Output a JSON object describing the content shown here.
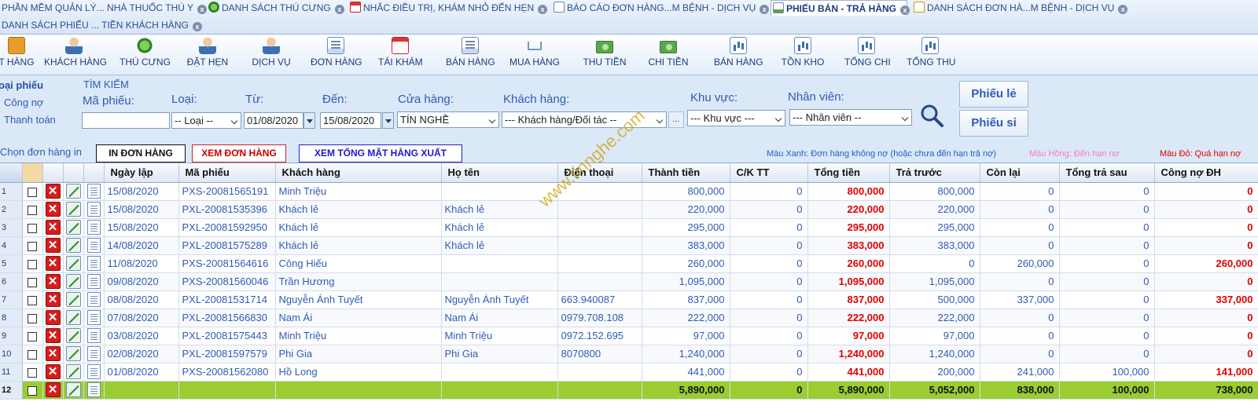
{
  "tabs": [
    {
      "label": "PHẦN MỀM QUẢN LÝ... NHÀ THUỐC THÚ Y",
      "icon": "app-icon",
      "active": false
    },
    {
      "label": "DANH SÁCH THÚ CƯNG",
      "icon": "pet-icon",
      "active": false
    },
    {
      "label": "NHẮC ĐIỀU TRỊ, KHÁM NHỎ ĐẾN HẸN",
      "icon": "calendar-icon",
      "active": false
    },
    {
      "label": "BÁO CÁO ĐƠN HÀNG...M BỆNH - DỊCH VỤ",
      "icon": "report-icon",
      "active": false
    },
    {
      "label": "PHIẾU BÁN - TRẢ HÀNG",
      "icon": "receipt-icon",
      "active": true
    },
    {
      "label": "DANH SÁCH ĐƠN HÀ...M BỆNH - DỊCH VỤ",
      "icon": "document-icon",
      "active": false
    },
    {
      "label": "DANH SÁCH PHIẾU ... TIỀN KHÁCH HÀNG",
      "icon": "",
      "active": false
    }
  ],
  "toolbar": [
    "T HÀNG",
    "KHÁCH HÀNG",
    "THÚ CƯNG",
    "ĐẶT HẸN",
    "DỊCH VỤ",
    "ĐƠN HÀNG",
    "TÁI KHÁM",
    "BÁN HÀNG",
    "MUA HÀNG",
    "THU TIỀN",
    "CHI TIỀN",
    "BÁN HÀNG",
    "TỒN KHO",
    "TỔNG CHI",
    "TỔNG THU"
  ],
  "filter": {
    "loai_phieu_label": "oại phiếu",
    "cong_no": "Công nợ",
    "thanh_toan": "Thanh toán",
    "tim_kiem": "TÌM KIẾM",
    "ma_phieu_label": "Mã phiếu:",
    "loai_label": "Loại:",
    "tu_label": "Từ:",
    "den_label": "Đến:",
    "cua_hang_label": "Cửa hàng:",
    "khach_hang_label": "Khách hàng:",
    "khu_vuc_label": "Khu vực:",
    "nhan_vien_label": "Nhân viên:",
    "ma_phieu_value": "",
    "loai_value": "-- Loại --",
    "tu_value": "01/08/2020",
    "den_value": "15/08/2020",
    "cua_hang_value": "TÍN NGHỀ",
    "khach_hang_value": "--- Khách hàng/Đối tác --",
    "more": "...",
    "khu_vuc_value": "--- Khu vực ---",
    "nhan_vien_value": "--- Nhân viên --",
    "phieu_le": "Phiếu lẻ",
    "phieu_si": "Phiếu sỉ"
  },
  "actions": {
    "chon_label": "Chọn đơn hàng in",
    "in": "IN ĐƠN HÀNG",
    "xem": "XEM ĐƠN HÀNG",
    "xem_tong": "XEM TỔNG MẶT HÀNG XUẤT",
    "legend_xanh": "Màu Xanh: Đơn hàng không nợ (hoặc chưa đến hạn trả nợ)",
    "legend_hong": "Màu Hồng: Đến hạn nợ",
    "legend_do": "Màu Đỏ: Quá hạn nợ",
    "color_xanh": "#1f5fbf",
    "color_hong": "#f07fc0",
    "color_do": "#e00000"
  },
  "columns": [
    "Ngày lập",
    "Mã phiếu",
    "Khách hàng",
    "Họ tên",
    "Điện thoại",
    "Thành tiền",
    "C/K TT",
    "Tổng tiền",
    "Trả trước",
    "Còn lại",
    "Tổng trả sau",
    "Công nợ ĐH"
  ],
  "rows": [
    {
      "n": "1",
      "date": "15/08/2020",
      "code": "PXS-20081565191",
      "customer": "Minh Triệu",
      "name": "",
      "phone": "",
      "amount": "800,000",
      "ck": "0",
      "total": "800,000",
      "prepaid": "800,000",
      "remain": "0",
      "later": "0",
      "debt": "0"
    },
    {
      "n": "2",
      "date": "15/08/2020",
      "code": "PXL-20081535396",
      "customer": "Khách lẻ",
      "name": "Khách lẻ",
      "phone": "",
      "amount": "220,000",
      "ck": "0",
      "total": "220,000",
      "prepaid": "220,000",
      "remain": "0",
      "later": "0",
      "debt": "0"
    },
    {
      "n": "3",
      "date": "15/08/2020",
      "code": "PXL-20081592950",
      "customer": "Khách lẻ",
      "name": "Khách lẻ",
      "phone": "",
      "amount": "295,000",
      "ck": "0",
      "total": "295,000",
      "prepaid": "295,000",
      "remain": "0",
      "later": "0",
      "debt": "0"
    },
    {
      "n": "4",
      "date": "14/08/2020",
      "code": "PXL-20081575289",
      "customer": "Khách lẻ",
      "name": "Khách lẻ",
      "phone": "",
      "amount": "383,000",
      "ck": "0",
      "total": "383,000",
      "prepaid": "383,000",
      "remain": "0",
      "later": "0",
      "debt": "0"
    },
    {
      "n": "5",
      "date": "11/08/2020",
      "code": "PXS-20081564616",
      "customer": "Công Hiếu",
      "name": "",
      "phone": "",
      "amount": "260,000",
      "ck": "0",
      "total": "260,000",
      "prepaid": "0",
      "remain": "260,000",
      "later": "0",
      "debt": "260,000"
    },
    {
      "n": "6",
      "date": "09/08/2020",
      "code": "PXS-20081560046",
      "customer": "Trần Hương",
      "name": "",
      "phone": "",
      "amount": "1,095,000",
      "ck": "0",
      "total": "1,095,000",
      "prepaid": "1,095,000",
      "remain": "0",
      "later": "0",
      "debt": "0"
    },
    {
      "n": "7",
      "date": "08/08/2020",
      "code": "PXL-20081531714",
      "customer": "Nguyễn Ánh Tuyết",
      "name": "Nguyễn Ánh Tuyết",
      "phone": "663.940087",
      "amount": "837,000",
      "ck": "0",
      "total": "837,000",
      "prepaid": "500,000",
      "remain": "337,000",
      "later": "0",
      "debt": "337,000"
    },
    {
      "n": "8",
      "date": "07/08/2020",
      "code": "PXL-20081566830",
      "customer": "Nam Ái",
      "name": "Nam Ái",
      "phone": "0979.708.108",
      "amount": "222,000",
      "ck": "0",
      "total": "222,000",
      "prepaid": "222,000",
      "remain": "0",
      "later": "0",
      "debt": "0"
    },
    {
      "n": "9",
      "date": "03/08/2020",
      "code": "PXL-20081575443",
      "customer": "Minh Triệu",
      "name": "Minh Triệu",
      "phone": "0972.152.695",
      "amount": "97,000",
      "ck": "0",
      "total": "97,000",
      "prepaid": "97,000",
      "remain": "0",
      "later": "0",
      "debt": "0"
    },
    {
      "n": "10",
      "date": "02/08/2020",
      "code": "PXL-20081597579",
      "customer": "Phi Gia",
      "name": "Phi Gia",
      "phone": "8070800",
      "amount": "1,240,000",
      "ck": "0",
      "total": "1,240,000",
      "prepaid": "1,240,000",
      "remain": "0",
      "later": "0",
      "debt": "0"
    },
    {
      "n": "11",
      "date": "01/08/2020",
      "code": "PXS-20081562080",
      "customer": "Hồ Long",
      "name": "",
      "phone": "",
      "amount": "441,000",
      "ck": "0",
      "total": "441,000",
      "prepaid": "200,000",
      "remain": "241,000",
      "later": "100,000",
      "debt": "141,000"
    }
  ],
  "summary": {
    "n": "12",
    "amount": "5,890,000",
    "ck": "0",
    "total": "5,890,000",
    "prepaid": "5,052,000",
    "remain": "838,000",
    "later": "100,000",
    "debt": "738,000"
  },
  "watermark": "www.tinnghe.com"
}
